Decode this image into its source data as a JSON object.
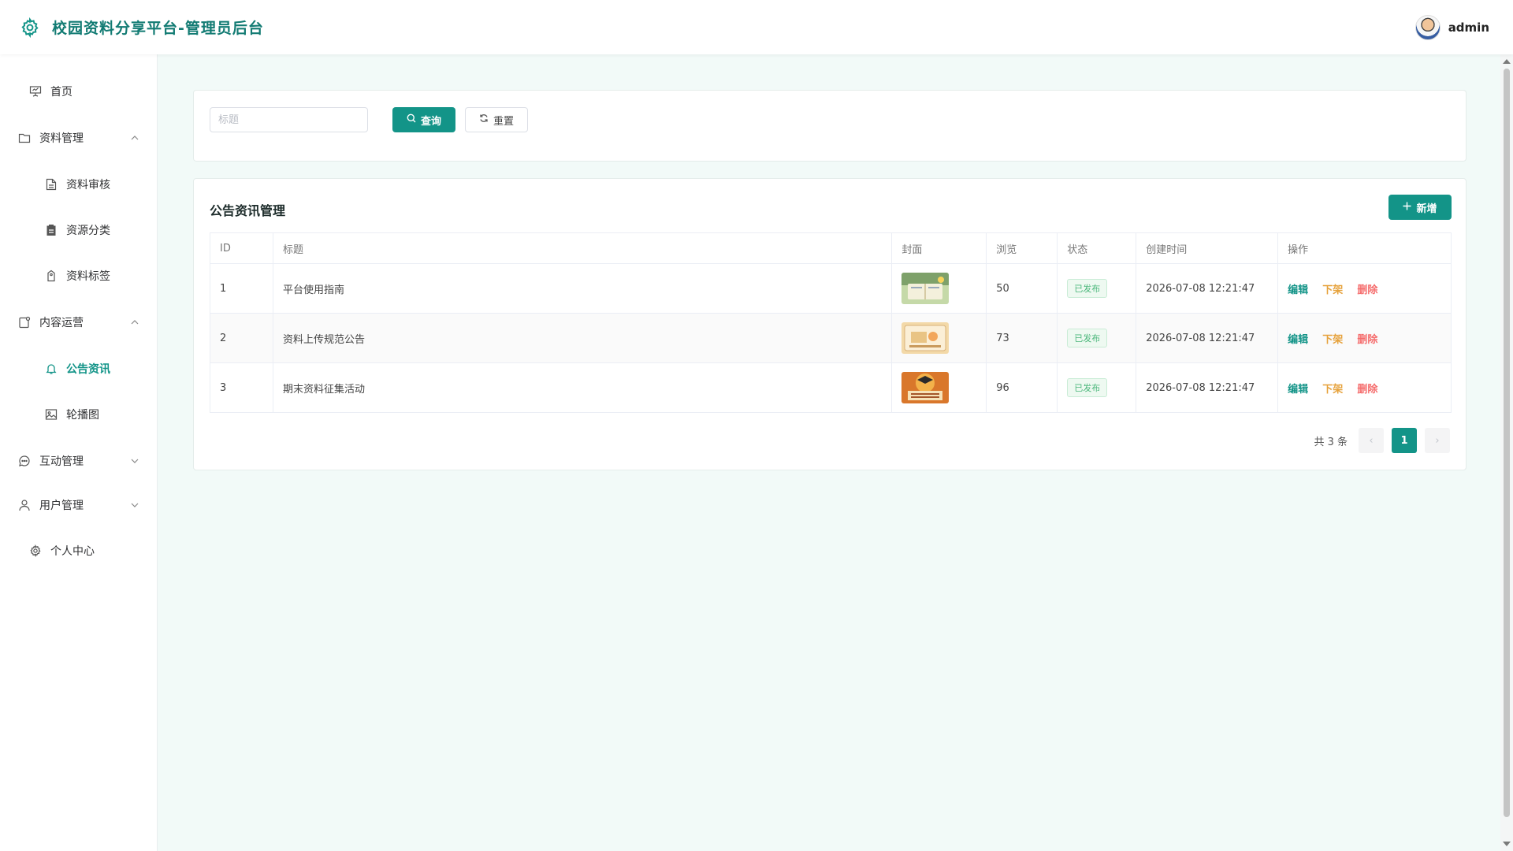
{
  "header": {
    "title": "校园资料分享平台-管理员后台",
    "username": "admin"
  },
  "sidebar": {
    "items": [
      {
        "label": "首页",
        "icon": "presentation-icon"
      },
      {
        "label": "资料管理",
        "icon": "folder-icon",
        "expanded": true
      },
      {
        "label": "资料审核",
        "icon": "document-icon"
      },
      {
        "label": "资源分类",
        "icon": "clipboard-icon"
      },
      {
        "label": "资料标签",
        "icon": "tag-icon"
      },
      {
        "label": "内容运营",
        "icon": "notebook-icon",
        "expanded": true
      },
      {
        "label": "公告资讯",
        "icon": "bell-icon",
        "active": true
      },
      {
        "label": "轮播图",
        "icon": "picture-icon"
      },
      {
        "label": "互动管理",
        "icon": "chat-icon",
        "expanded": false
      },
      {
        "label": "用户管理",
        "icon": "user-icon",
        "expanded": false
      },
      {
        "label": "个人中心",
        "icon": "gear-icon"
      }
    ]
  },
  "filter": {
    "title_placeholder": "标题",
    "query_label": "查询",
    "reset_label": "重置"
  },
  "table_card": {
    "title": "公告资讯管理",
    "add_label": "新增",
    "columns": [
      "ID",
      "标题",
      "封面",
      "浏览",
      "状态",
      "创建时间",
      "操作"
    ],
    "rows": [
      {
        "id": "1",
        "title": "平台使用指南",
        "views": "50",
        "status": "已发布",
        "created": "2026-07-08 12:21:47"
      },
      {
        "id": "2",
        "title": "资料上传规范公告",
        "views": "73",
        "status": "已发布",
        "created": "2026-07-08 12:21:47"
      },
      {
        "id": "3",
        "title": "期末资料征集活动",
        "views": "96",
        "status": "已发布",
        "created": "2026-07-08 12:21:47"
      }
    ],
    "actions": {
      "edit": "编辑",
      "offline": "下架",
      "delete": "删除"
    }
  },
  "pagination": {
    "total_text": "共 3 条",
    "current_page": "1"
  },
  "colors": {
    "primary": "#139488",
    "warning": "#e6a23c",
    "danger": "#f56c6c",
    "success": "#4bb77b"
  }
}
